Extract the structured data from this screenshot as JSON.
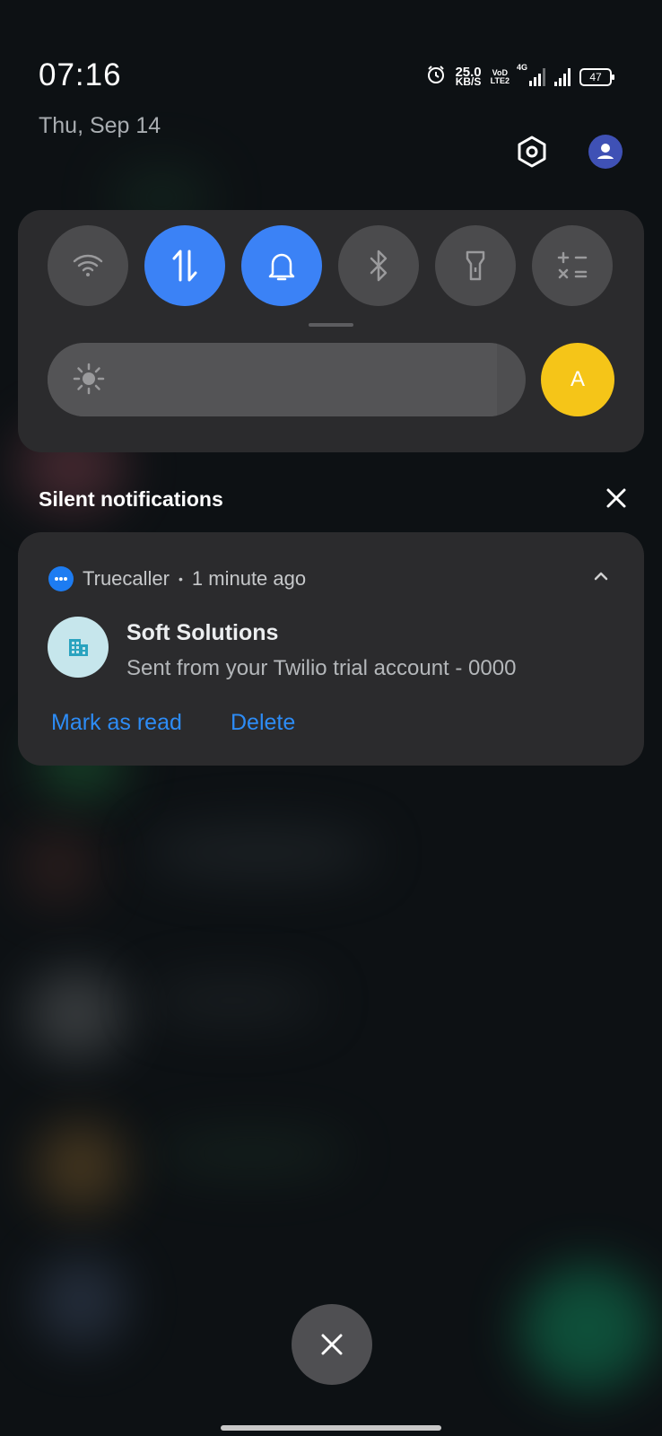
{
  "status_bar": {
    "time": "07:16",
    "date": "Thu, Sep 14",
    "net_speed_value": "25.0",
    "net_speed_unit": "KB/S",
    "volte_top": "VoD",
    "volte_bottom": "LTE2",
    "network_type": "4G",
    "battery": "47"
  },
  "quick_settings": {
    "tiles": [
      {
        "name": "wifi",
        "active": false
      },
      {
        "name": "mobile-data",
        "active": true
      },
      {
        "name": "sound",
        "active": true
      },
      {
        "name": "bluetooth",
        "active": false
      },
      {
        "name": "flashlight",
        "active": false
      },
      {
        "name": "calculator",
        "active": false
      }
    ],
    "brightness_level": 0.94,
    "auto_brightness_label": "A"
  },
  "notifications": {
    "section_title": "Silent notifications",
    "items": [
      {
        "app_name": "Truecaller",
        "separator": "•",
        "time_ago": "1 minute ago",
        "sender": "Soft Solutions",
        "message": "Sent from your Twilio trial account - 0000",
        "actions": [
          "Mark as read",
          "Delete"
        ]
      }
    ]
  },
  "colors": {
    "accent_blue": "#3b82f6",
    "action_blue": "#2d8cf6",
    "auto_yellow": "#f5c518",
    "panel": "#2b2b2d",
    "background": "#0d1114"
  }
}
